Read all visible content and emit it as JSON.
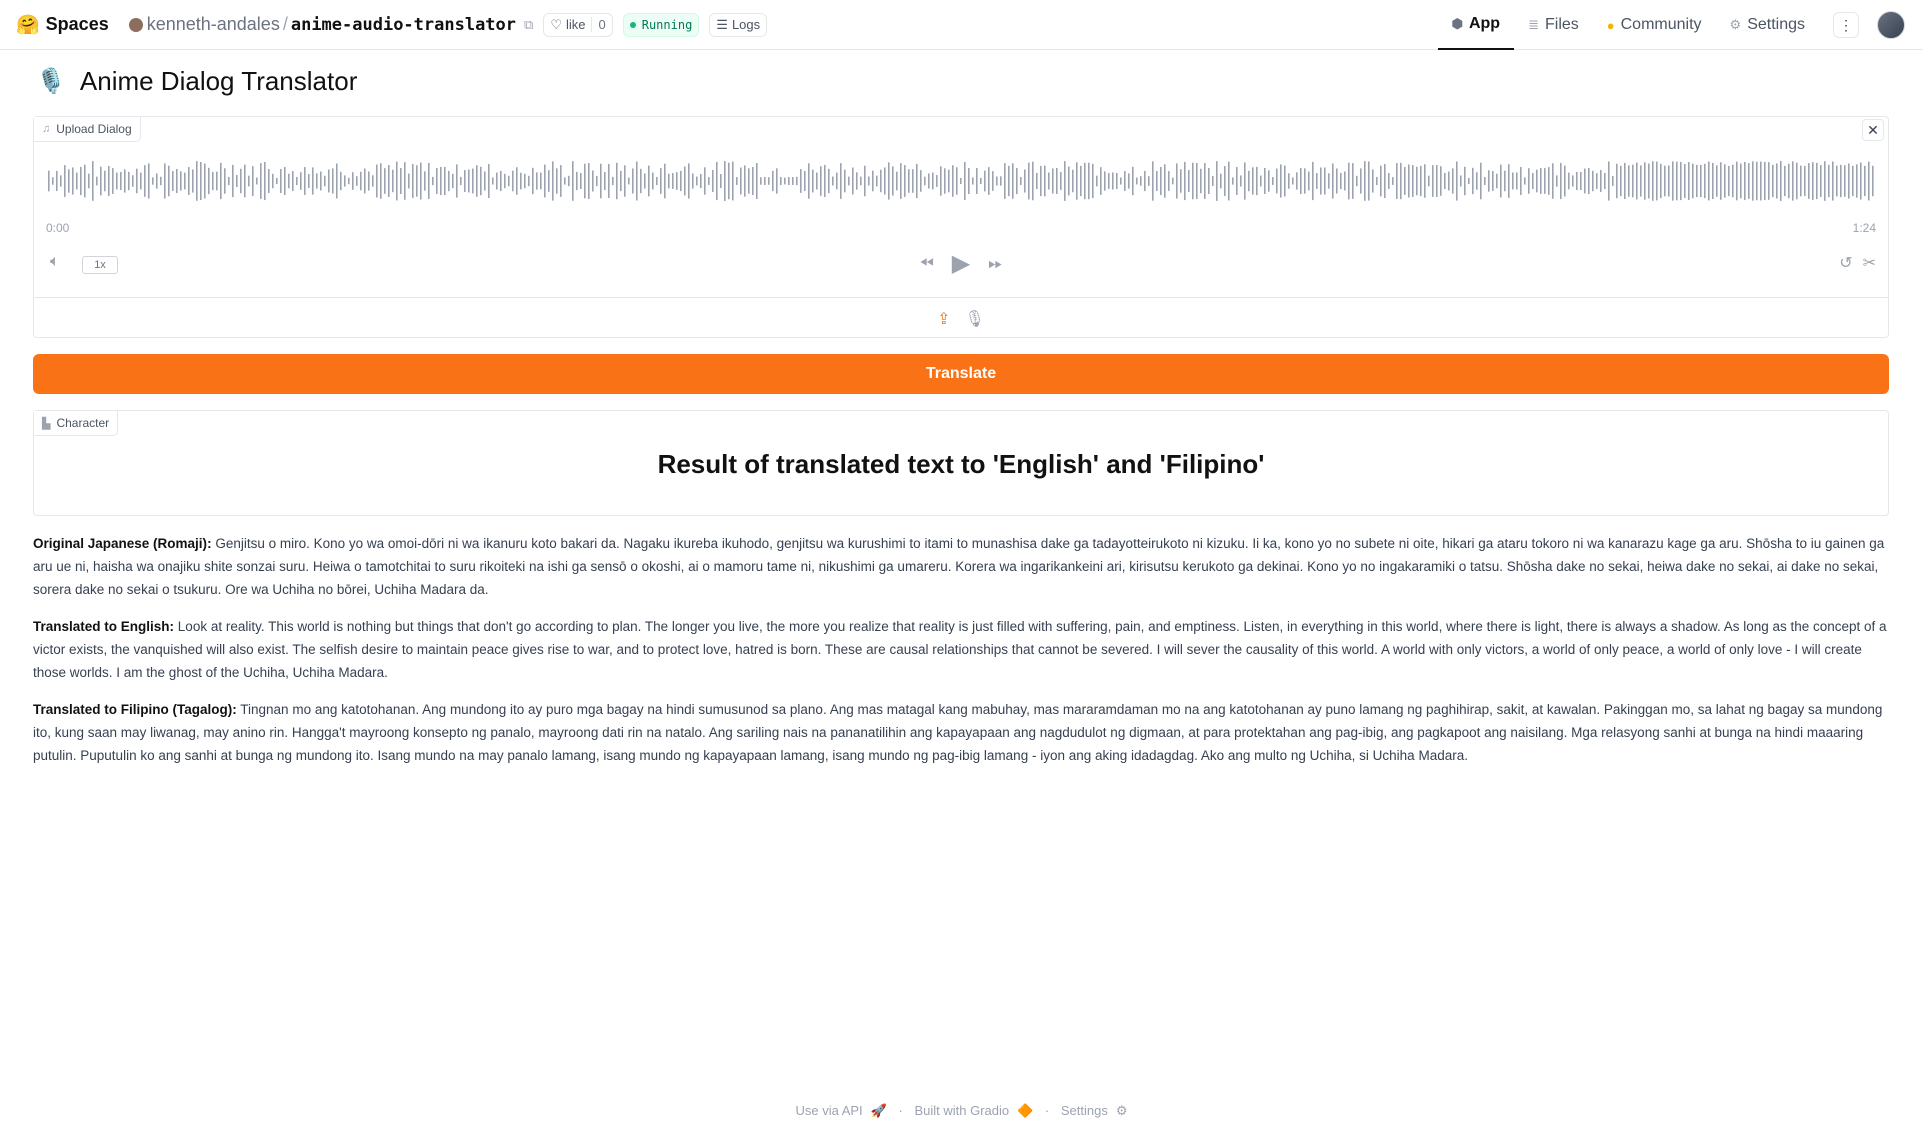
{
  "topbar": {
    "brand_label": "Spaces",
    "brand_icon": "hugging-face-logo",
    "owner": "kenneth-andales",
    "repo": "anime-audio-translator",
    "like_label": "like",
    "like_count": "0",
    "status": "Running",
    "logs_label": "Logs",
    "nav": [
      {
        "label": "App",
        "icon": "app-icon",
        "active": true
      },
      {
        "label": "Files",
        "icon": "files-icon",
        "active": false
      },
      {
        "label": "Community",
        "icon": "community-icon",
        "active": false
      },
      {
        "label": "Settings",
        "icon": "settings-icon",
        "active": false
      }
    ]
  },
  "app": {
    "title": "Anime Dialog Translator",
    "title_icon": "microphone-emoji",
    "audio": {
      "label": "Upload Dialog",
      "time_start": "0:00",
      "time_end": "1:24",
      "playback_rate": "1x"
    },
    "translate_label": "Translate",
    "character_label": "Character",
    "result_heading": "Result of translated text to 'English' and 'Filipino'",
    "results": [
      {
        "label": "Original Japanese (Romaji)",
        "text": "Genjitsu o miro. Kono yo wa omoi-dōri ni wa ikanuru koto bakari da. Nagaku ikureba ikuhodo, genjitsu wa kurushimi to itami to munashisa dake ga tadayotteirukoto ni kizuku. Ii ka, kono yo no subete ni oite, hikari ga ataru tokoro ni wa kanarazu kage ga aru. Shōsha to iu gainen ga aru ue ni, haisha wa onajiku shite sonzai suru. Heiwa o tamotchitai to suru rikoiteki na ishi ga sensō o okoshi, ai o mamoru tame ni, nikushimi ga umareru. Korera wa ingarikankeini ari, kirisutsu kerukoto ga dekinai. Kono yo no ingakaramiki o tatsu. Shōsha dake no sekai, heiwa dake no sekai, ai dake no sekai, sorera dake no sekai o tsukuru. Ore wa Uchiha no bōrei, Uchiha Madara da."
      },
      {
        "label": "Translated to English",
        "text": "Look at reality. This world is nothing but things that don't go according to plan. The longer you live, the more you realize that reality is just filled with suffering, pain, and emptiness. Listen, in everything in this world, where there is light, there is always a shadow. As long as the concept of a victor exists, the vanquished will also exist. The selfish desire to maintain peace gives rise to war, and to protect love, hatred is born. These are causal relationships that cannot be severed. I will sever the causality of this world. A world with only victors, a world of only peace, a world of only love - I will create those worlds. I am the ghost of the Uchiha, Uchiha Madara."
      },
      {
        "label": "Translated to Filipino (Tagalog)",
        "text": "Tingnan mo ang katotohanan. Ang mundong ito ay puro mga bagay na hindi sumusunod sa plano. Ang mas matagal kang mabuhay, mas mararamdaman mo na ang katotohanan ay puno lamang ng paghihirap, sakit, at kawalan. Pakinggan mo, sa lahat ng bagay sa mundong ito, kung saan may liwanag, may anino rin. Hangga't mayroong konsepto ng panalo, mayroong dati rin na natalo. Ang sariling nais na pananatilihin ang kapayapaan ang nagdudulot ng digmaan, at para protektahan ang pag-ibig, ang pagkapoot ang naisilang. Mga relasyong sanhi at bunga na hindi maaaring putulin. Puputulin ko ang sanhi at bunga ng mundong ito. Isang mundo na may panalo lamang, isang mundo ng kapayapaan lamang, isang mundo ng pag-ibig lamang - iyon ang aking idadagdag. Ako ang multo ng Uchiha, si Uchiha Madara."
      }
    ]
  },
  "footer": {
    "api": "Use via API",
    "built": "Built with Gradio",
    "settings": "Settings",
    "sep": "·"
  },
  "colors": {
    "accent": "#f97316",
    "running": "#10b981"
  }
}
